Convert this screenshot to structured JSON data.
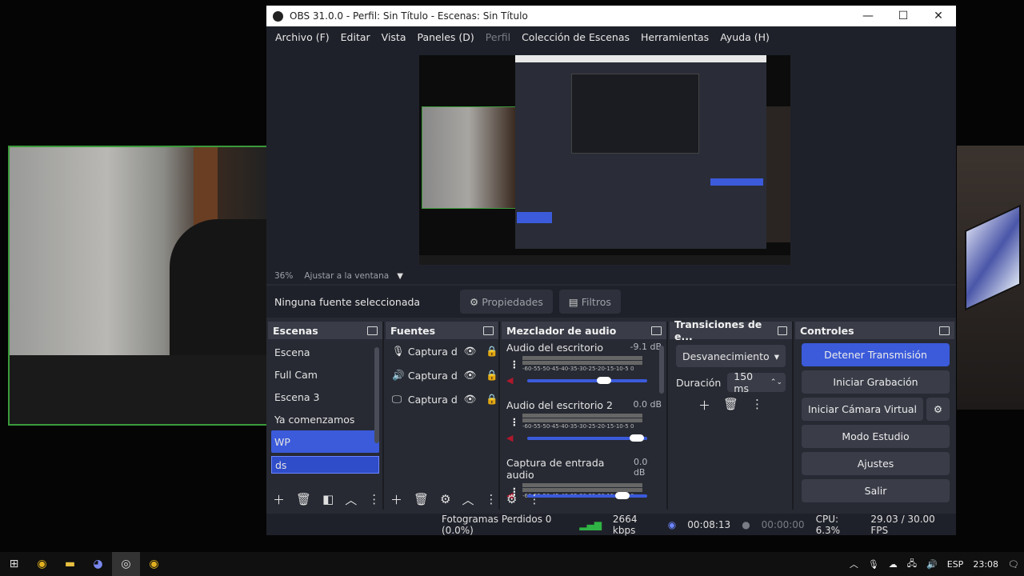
{
  "window": {
    "title": "OBS 31.0.0 - Perfil: Sin Título - Escenas: Sin Título",
    "minimize": "—",
    "maximize": "☐",
    "close": "✕"
  },
  "menu": [
    "Archivo (F)",
    "Editar",
    "Vista",
    "Paneles (D)",
    "Perfil",
    "Colección de Escenas",
    "Herramientas",
    "Ayuda (H)"
  ],
  "preview": {
    "zoom": "36%",
    "fit": "Ajustar a la ventana"
  },
  "source_toolbar": {
    "none_selected": "Ninguna fuente seleccionada",
    "properties": "Propiedades",
    "filters": "Filtros"
  },
  "scenes": {
    "title": "Escenas",
    "items": [
      "Escena",
      "Full Cam",
      "Escena 3",
      "Ya comenzamos",
      "WP"
    ],
    "editing": "ds"
  },
  "sources": {
    "title": "Fuentes",
    "items": [
      {
        "label": "Captura de",
        "icon": "microphone-icon"
      },
      {
        "label": "Captura de",
        "icon": "speaker-icon"
      },
      {
        "label": "Captura de",
        "icon": "monitor-icon"
      }
    ]
  },
  "mixer": {
    "title": "Mezclador de audio",
    "channels": [
      {
        "name": "Audio del escritorio",
        "db": "-9.1 dB",
        "level": 0.7
      },
      {
        "name": "Audio del escritorio 2",
        "db": "0.0 dB",
        "level": 0.97
      },
      {
        "name": "Captura de entrada audio",
        "db": "0.0 dB",
        "level": 0.85
      }
    ],
    "ticks": "-60-55-50-45-40-35-30-25-20-15-10-5 0"
  },
  "transitions": {
    "title": "Transiciones de e...",
    "selected": "Desvanecimiento",
    "duration_label": "Duración",
    "duration": "150 ms"
  },
  "controls": {
    "title": "Controles",
    "buttons": [
      "Detener Transmisión",
      "Iniciar Grabación",
      "Iniciar Cámara Virtual",
      "Modo Estudio",
      "Ajustes",
      "Salir"
    ]
  },
  "status": {
    "dropped": "Fotogramas Perdidos 0 (0.0%)",
    "bitrate": "2664 kbps",
    "stream_time": "00:08:13",
    "rec_time": "00:00:00",
    "cpu": "CPU: 6.3%",
    "fps": "29.03 / 30.00 FPS"
  },
  "taskbar": {
    "lang": "ESP",
    "time": "23:08"
  },
  "colors": {
    "accent": "#3b5bdb",
    "dock_bg": "#272a33",
    "header_bg": "#3a3d48",
    "cam_border": "#3a9a3a"
  }
}
